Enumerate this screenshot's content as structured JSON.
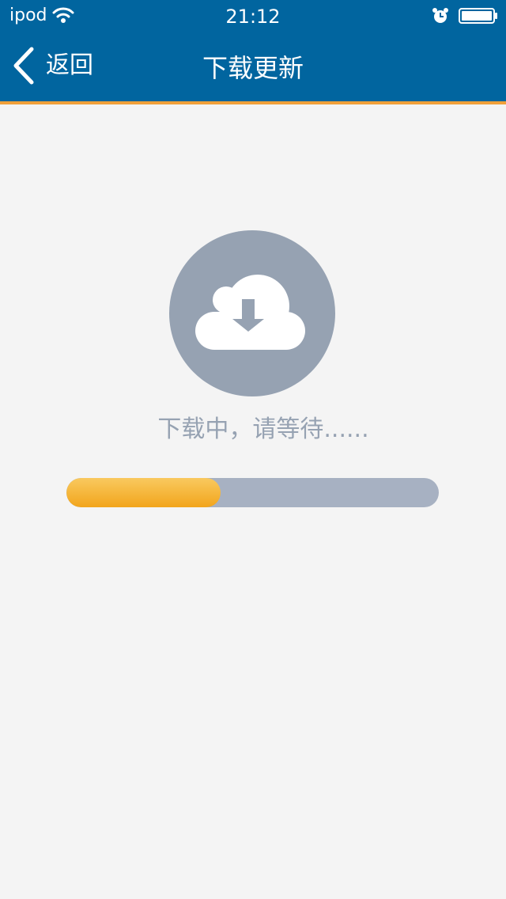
{
  "status_bar": {
    "carrier": "ipod",
    "time": "21:12",
    "wifi_icon": "wifi-icon",
    "alarm_icon": "alarm-icon",
    "battery_icon": "battery-icon"
  },
  "nav": {
    "back_label": "返回",
    "back_icon": "chevron-left-icon",
    "title": "下载更新"
  },
  "download": {
    "icon": "cloud-download-icon",
    "status_text": "下载中，请等待......",
    "progress_fraction": 0.413
  },
  "colors": {
    "header_background": "#01659f",
    "header_accent_line": "#f0a03a",
    "page_background": "#f4f4f4",
    "icon_circle": "#96a2b2",
    "progress_track": "#a7b1c2",
    "progress_fill": "#f2a51c"
  }
}
